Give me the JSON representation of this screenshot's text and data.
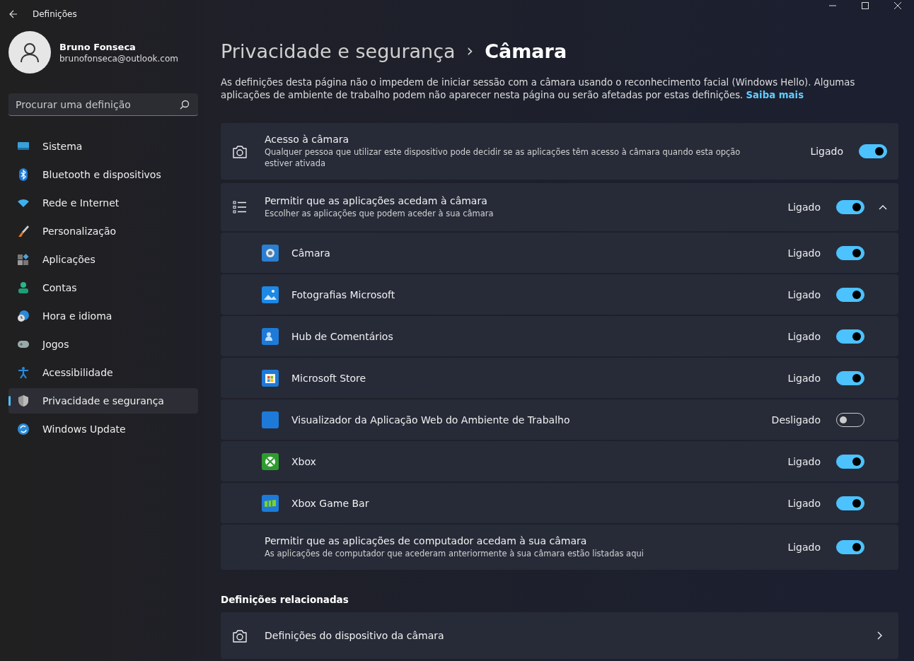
{
  "window": {
    "title": "Definições"
  },
  "account": {
    "name": "Bruno Fonseca",
    "email": "brunofonseca@outlook.com"
  },
  "search": {
    "placeholder": "Procurar uma definição"
  },
  "sidebar": {
    "items": [
      {
        "label": "Sistema",
        "kind": "display",
        "selected": false
      },
      {
        "label": "Bluetooth e dispositivos",
        "kind": "bluetooth",
        "selected": false
      },
      {
        "label": "Rede e Internet",
        "kind": "wifi",
        "selected": false
      },
      {
        "label": "Personalização",
        "kind": "brush",
        "selected": false
      },
      {
        "label": "Aplicações",
        "kind": "apps",
        "selected": false
      },
      {
        "label": "Contas",
        "kind": "person",
        "selected": false
      },
      {
        "label": "Hora e idioma",
        "kind": "clock",
        "selected": false
      },
      {
        "label": "Jogos",
        "kind": "gamepad",
        "selected": false
      },
      {
        "label": "Acessibilidade",
        "kind": "accessibility",
        "selected": false
      },
      {
        "label": "Privacidade e segurança",
        "kind": "shield",
        "selected": true
      },
      {
        "label": "Windows Update",
        "kind": "update",
        "selected": false
      }
    ]
  },
  "breadcrumb": {
    "parent": "Privacidade e segurança",
    "separator": "›",
    "current": "Câmara"
  },
  "intro": {
    "text": "As definições desta página não o impedem de iniciar sessão com a câmara usando o reconhecimento facial (Windows Hello). Algumas aplicações de ambiente de trabalho podem não aparecer nesta página ou serão afetadas por estas definições.",
    "link": "Saiba mais"
  },
  "camera_access": {
    "title": "Acesso à câmara",
    "description": "Qualquer pessoa que utilizar este dispositivo pode decidir se as aplicações têm acesso à câmara quando esta opção estiver ativada",
    "state_label": "Ligado",
    "on": true
  },
  "app_access": {
    "title": "Permitir que as aplicações acedam à câmara",
    "description": "Escolher as aplicações que podem aceder à sua câmara",
    "state_label": "Ligado",
    "on": true,
    "expanded": true,
    "apps": [
      {
        "name": "Câmara",
        "kind": "camera",
        "state_label": "Ligado",
        "on": true
      },
      {
        "name": "Fotografias Microsoft",
        "kind": "photos",
        "state_label": "Ligado",
        "on": true
      },
      {
        "name": "Hub de Comentários",
        "kind": "feedback",
        "state_label": "Ligado",
        "on": true
      },
      {
        "name": "Microsoft Store",
        "kind": "store",
        "state_label": "Ligado",
        "on": true
      },
      {
        "name": "Visualizador da Aplicação Web do Ambiente de Trabalho",
        "kind": "webview",
        "state_label": "Desligado",
        "on": false
      },
      {
        "name": "Xbox",
        "kind": "xbox",
        "state_label": "Ligado",
        "on": true
      },
      {
        "name": "Xbox Game Bar",
        "kind": "gamebar",
        "state_label": "Ligado",
        "on": true
      }
    ]
  },
  "desktop_access": {
    "title": "Permitir que as aplicações de computador acedam à sua câmara",
    "description": "As aplicações de computador que acederam anteriormente à sua câmara estão listadas aqui",
    "state_label": "Ligado",
    "on": true
  },
  "related": {
    "heading": "Definições relacionadas",
    "items": [
      {
        "label": "Definições do dispositivo da câmara"
      }
    ]
  }
}
